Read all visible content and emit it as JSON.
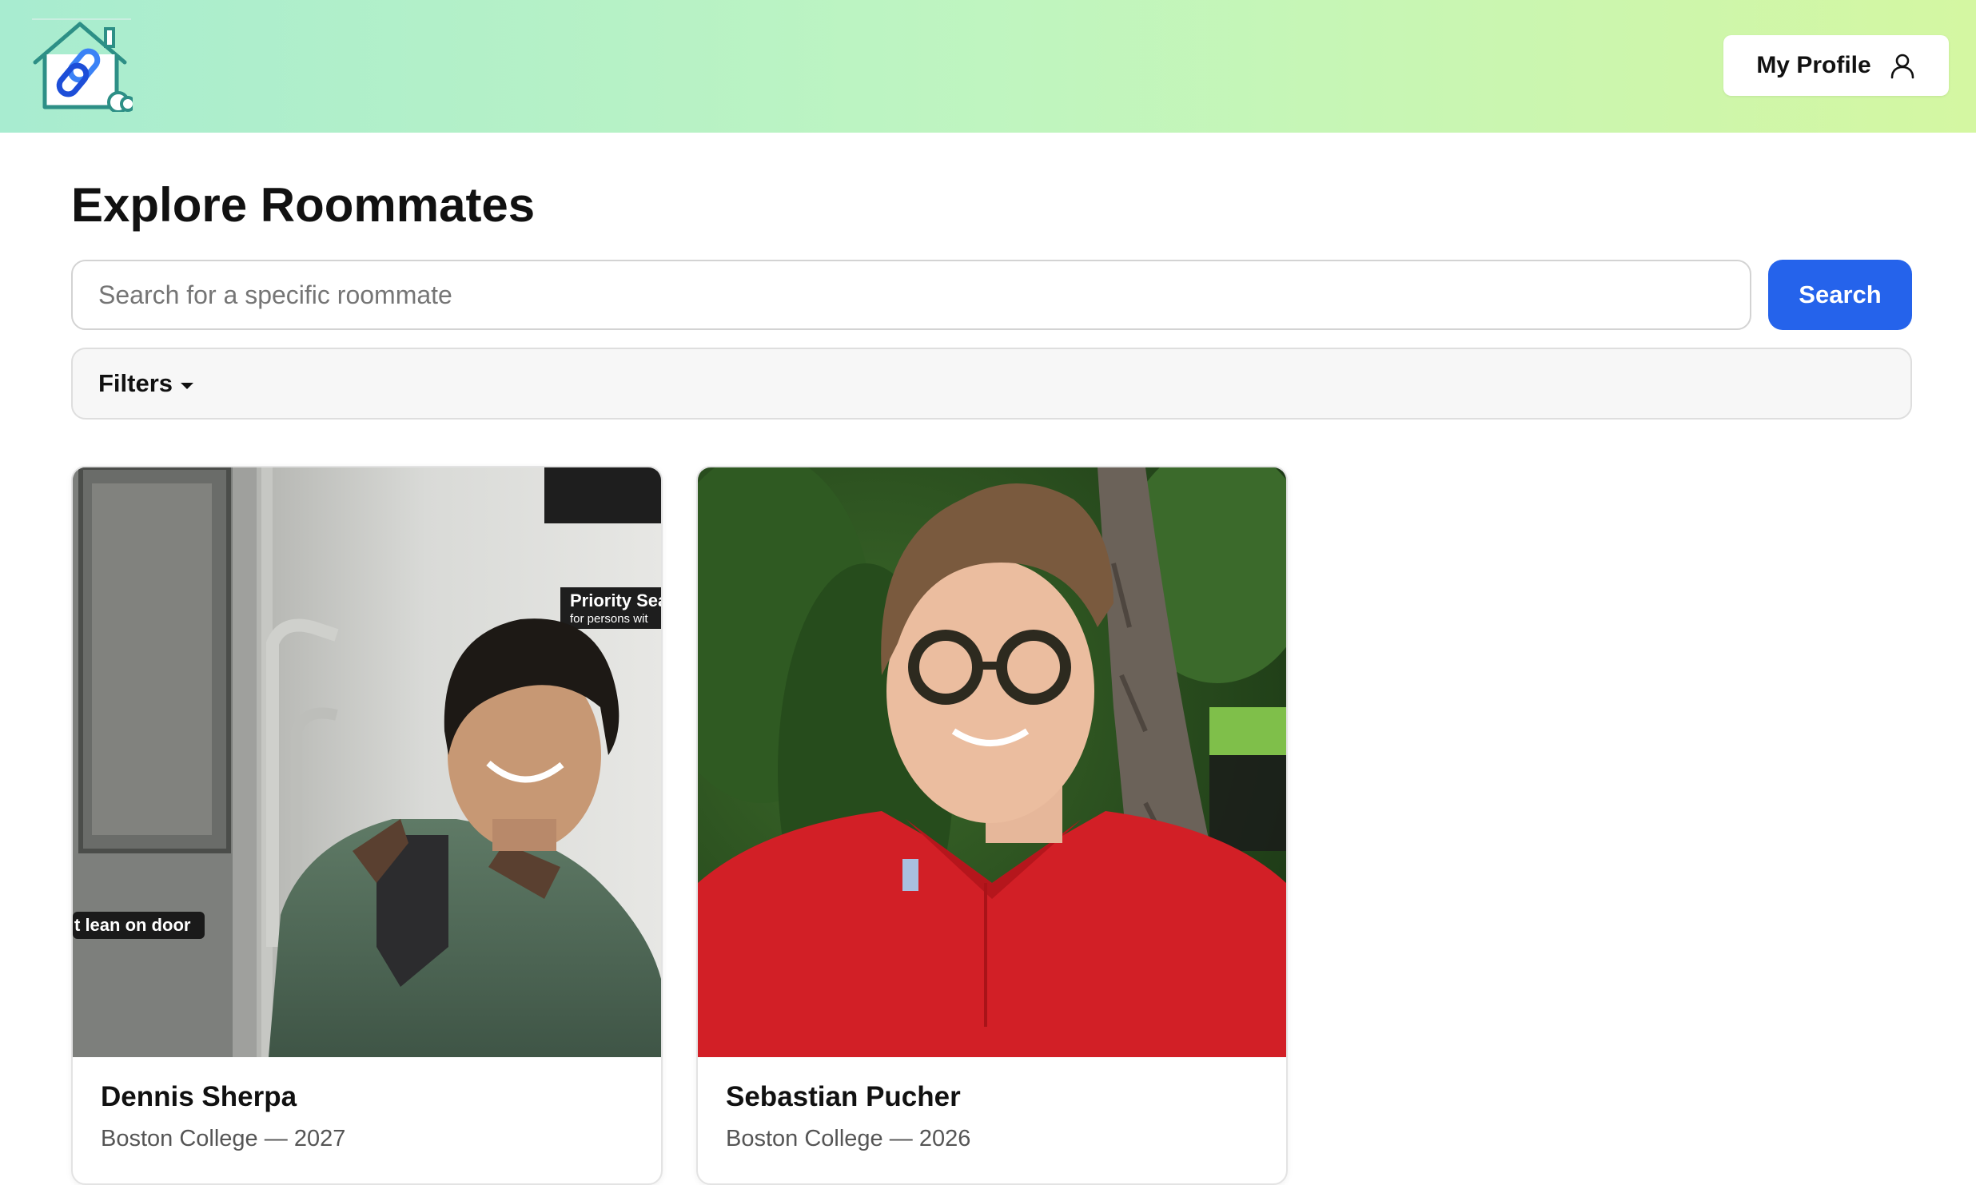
{
  "header": {
    "logo_icon": "house-link-icon",
    "profile_button": {
      "label": "My Profile",
      "icon": "person-icon"
    },
    "gradient": [
      "#a8ecd0",
      "#d4f7a2"
    ]
  },
  "page": {
    "title": "Explore Roommates",
    "search": {
      "placeholder": "Search for a specific roommate",
      "value": "",
      "button_label": "Search",
      "button_color": "#2563eb"
    },
    "filters": {
      "label": "Filters",
      "icon": "caret-down-icon"
    }
  },
  "roommates": [
    {
      "name": "Dennis Sherpa",
      "school": "Boston College",
      "separator": "—",
      "year": "2027",
      "photo_text": {
        "door": "t lean on door",
        "sign_top": "Priority Sea",
        "sign_bottom": "for persons wit"
      }
    },
    {
      "name": "Sebastian Pucher",
      "school": "Boston College",
      "separator": "—",
      "year": "2026"
    }
  ]
}
